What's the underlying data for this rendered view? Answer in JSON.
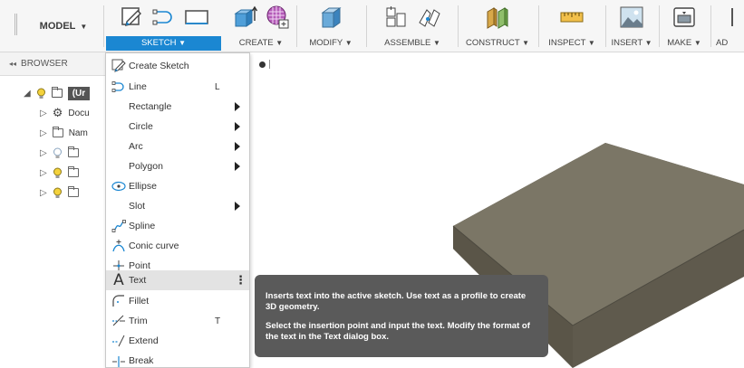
{
  "toolbar": {
    "model_label": "MODEL",
    "groups": [
      {
        "label": "SKETCH",
        "active": true
      },
      {
        "label": "CREATE"
      },
      {
        "label": "MODIFY"
      },
      {
        "label": "ASSEMBLE"
      },
      {
        "label": "CONSTRUCT"
      },
      {
        "label": "INSPECT"
      },
      {
        "label": "INSERT"
      },
      {
        "label": "MAKE"
      },
      {
        "label": "AD"
      }
    ],
    "caret": "▼",
    "active_color": "#1b87d2"
  },
  "browser": {
    "title": "BROWSER",
    "collapse_glyph": "◂◂",
    "rows": [
      {
        "label": "(Ur"
      },
      {
        "label": "Docu"
      },
      {
        "label": "Nam"
      },
      {
        "label": ""
      },
      {
        "label": ""
      },
      {
        "label": ""
      }
    ]
  },
  "menu": {
    "items": [
      {
        "label": "Create Sketch",
        "icon": "create-sketch-icon"
      },
      {
        "label": "Line",
        "shortcut": "L",
        "icon": "line-icon"
      },
      {
        "label": "Rectangle",
        "submenu": true
      },
      {
        "label": "Circle",
        "submenu": true
      },
      {
        "label": "Arc",
        "submenu": true
      },
      {
        "label": "Polygon",
        "submenu": true
      },
      {
        "label": "Ellipse",
        "icon": "ellipse-icon"
      },
      {
        "label": "Slot",
        "submenu": true
      },
      {
        "label": "Spline",
        "icon": "spline-icon"
      },
      {
        "label": "Conic curve",
        "icon": "conic-curve-icon"
      },
      {
        "label": "Point",
        "icon": "point-icon"
      },
      {
        "label": "Text",
        "icon": "text-icon",
        "highlighted": true,
        "more": "⋮"
      },
      {
        "label": "Fillet",
        "icon": "fillet-icon"
      },
      {
        "label": "Trim",
        "shortcut": "T",
        "icon": "trim-icon"
      },
      {
        "label": "Extend",
        "icon": "extend-icon"
      },
      {
        "label": "Break",
        "icon": "break-icon"
      }
    ]
  },
  "tooltip": {
    "line1": "Inserts text into the active sketch. Use text as a profile to create 3D geometry.",
    "line2": "Select the insertion point and input the text. Modify the format of the text in the Text dialog box."
  },
  "colors": {
    "block_top": "#7b7666",
    "block_side": "#5f5a4d",
    "block_edge": "#4d4a40",
    "tooltip_bg": "#5a5a5a"
  }
}
